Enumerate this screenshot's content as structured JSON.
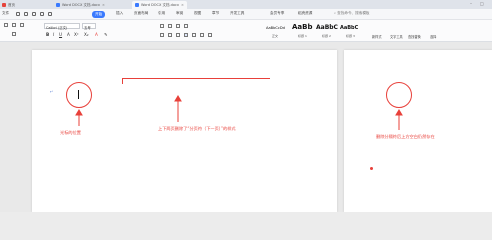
{
  "tabs": [
    {
      "label": "首页",
      "color": "#e5443b"
    },
    {
      "label": "Word DOCX 文档.docx",
      "color": "#3a7afe"
    },
    {
      "label": "Word DOCX 文档.docx",
      "color": "#3a7afe"
    }
  ],
  "menu": {
    "file": "文件",
    "items": [
      "开始",
      "插入",
      "页面布局",
      "引用",
      "审阅",
      "视图",
      "章节",
      "开发工具",
      "会员专享",
      "稻壳资源"
    ],
    "search": "查找命令、搜索模板"
  },
  "ribbon": {
    "font_name": "Calibri (正文)",
    "font_size": "五号",
    "styles": [
      {
        "preview": "AaBbCcDd",
        "label": "正文"
      },
      {
        "preview": "AaBb",
        "label": "标题 1"
      },
      {
        "preview": "AaBbC",
        "label": "标题 2"
      },
      {
        "preview": "AaBbC",
        "label": "标题 3"
      }
    ],
    "find_replace": "查找替换",
    "select": "选择",
    "text_tools": "文字工具",
    "new_style": "新样式"
  },
  "annotations": {
    "cursor_note": "光标的位置",
    "line_note": "上下两页删除了“分页符（下一页）”的样式",
    "right_note": "删除分隔符后上方空白仍然存在"
  }
}
